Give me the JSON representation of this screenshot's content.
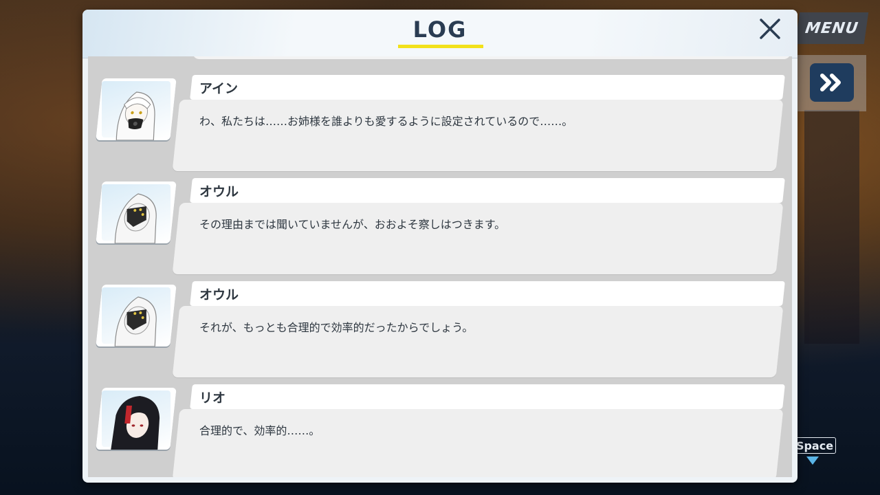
{
  "hud": {
    "menu_label": "MENU",
    "skip_icon": "fast-forward-icon",
    "space_label": "Space",
    "advance_icon": "down-triangle-icon"
  },
  "log": {
    "title": "LOG",
    "close_icon": "close-icon",
    "accent_color": "#f2e11a",
    "entries": [
      {
        "speaker": "アイン",
        "text": "わ、私たちは……お姉様を誰よりも愛するように設定されているので……。",
        "avatar": "white-hair-girl-mask-icon"
      },
      {
        "speaker": "オウル",
        "text": "その理由までは聞いていませんが、おおよそ察しはつきます。",
        "avatar": "white-hair-visor-icon"
      },
      {
        "speaker": "オウル",
        "text": "それが、もっとも合理的で効率的だったからでしょう。",
        "avatar": "white-hair-visor-icon"
      },
      {
        "speaker": "リオ",
        "text": "合理的で、効率的……。",
        "avatar": "black-hair-girl-icon"
      }
    ]
  }
}
